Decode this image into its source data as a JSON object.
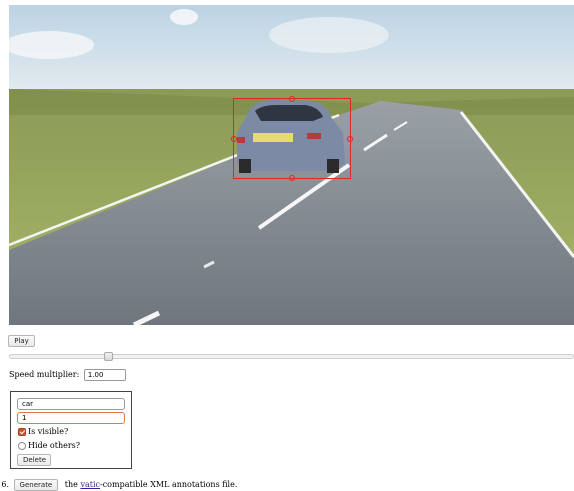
{
  "player": {
    "play_label": "Play",
    "speed_label": "Speed multiplier:",
    "speed_value": "1.00",
    "timeline_position": 0.17
  },
  "annotation": {
    "label": "car",
    "id": "1",
    "is_visible_label": "Is visible?",
    "is_visible_checked": true,
    "hide_others_label": "Hide others?",
    "hide_others_checked": false,
    "delete_label": "Delete",
    "box_color": "#e0262a"
  },
  "footer": {
    "step_number": "6.",
    "generate_label": "Generate",
    "text_before": "the",
    "link_text": "vatic",
    "text_after": "-compatible XML annotations file."
  }
}
